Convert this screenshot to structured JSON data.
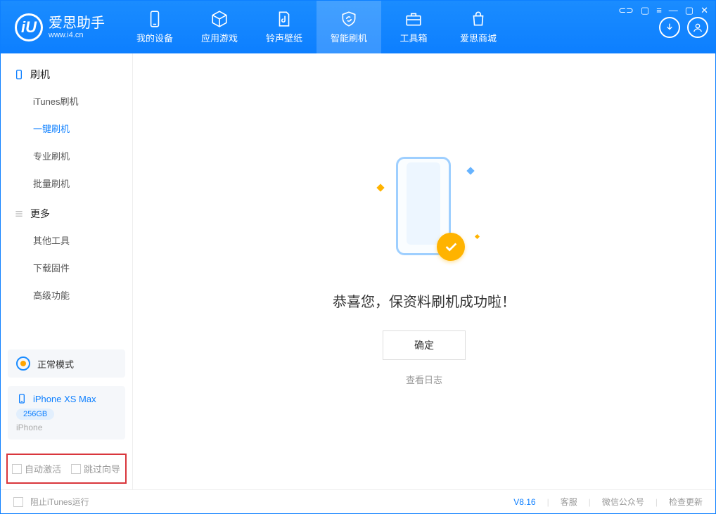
{
  "app": {
    "title": "爱思助手",
    "subtitle": "www.i4.cn",
    "logo_letter": "iU"
  },
  "nav": {
    "my_device": "我的设备",
    "apps_games": "应用游戏",
    "ringtones": "铃声壁纸",
    "smart_flash": "智能刷机",
    "toolbox": "工具箱",
    "store": "爱思商城"
  },
  "sidebar": {
    "group_flash": "刷机",
    "items_flash": [
      "iTunes刷机",
      "一键刷机",
      "专业刷机",
      "批量刷机"
    ],
    "group_more": "更多",
    "items_more": [
      "其他工具",
      "下载固件",
      "高级功能"
    ]
  },
  "mode": {
    "label": "正常模式"
  },
  "device": {
    "name": "iPhone XS Max",
    "storage": "256GB",
    "type": "iPhone"
  },
  "checks": {
    "auto_activate": "自动激活",
    "skip_guide": "跳过向导"
  },
  "content": {
    "success": "恭喜您，保资料刷机成功啦！",
    "ok": "确定",
    "view_log": "查看日志"
  },
  "footer": {
    "block_itunes": "阻止iTunes运行",
    "version": "V8.16",
    "support": "客服",
    "wechat": "微信公众号",
    "check_update": "检查更新"
  }
}
